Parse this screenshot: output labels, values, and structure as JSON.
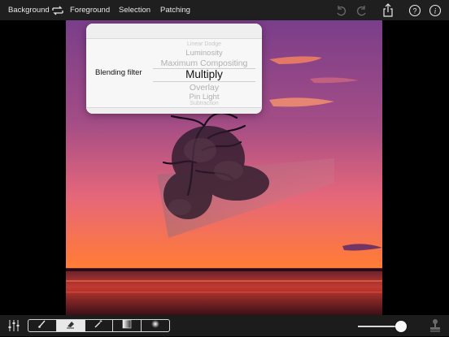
{
  "toolbar": {
    "background_label": "Background",
    "foreground_label": "Foreground",
    "selection_label": "Selection",
    "patching_label": "Patching",
    "icons": [
      "swap-icon",
      "undo-icon",
      "redo-icon",
      "share-icon",
      "help-icon",
      "info-icon"
    ]
  },
  "blend_popover": {
    "label": "Blending filter",
    "options": [
      "Linear Dodge",
      "Luminosity",
      "Maximum Compositing",
      "Multiply",
      "Overlay",
      "Pin Light",
      "Subtraction"
    ],
    "selected": "Multiply"
  },
  "bottom_toolbar": {
    "tools": [
      "brush-icon",
      "eraser-icon",
      "wand-icon",
      "gradient-icon",
      "radial-icon"
    ],
    "active_tool": "eraser-icon",
    "slider_value": 0.85,
    "icons": [
      "adjustments-icon",
      "stamp-icon"
    ]
  },
  "colors": {
    "topbar": "#1f1f1f",
    "popover": "#f7f7f7",
    "sky_top": "#7a3e8a",
    "sky_mid": "#e6677a",
    "horizon": "#ff7a3a"
  }
}
